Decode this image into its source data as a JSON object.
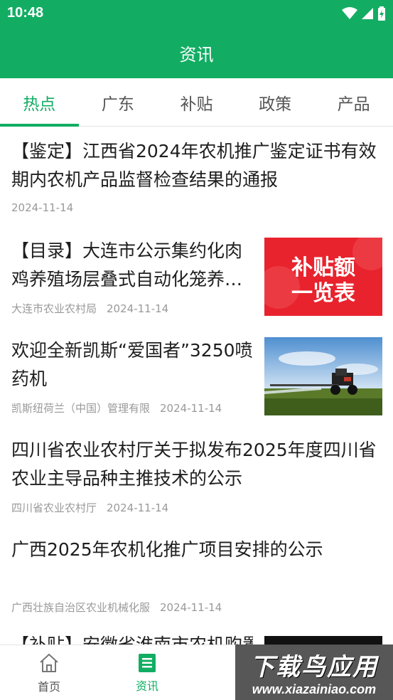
{
  "status_bar": {
    "time": "10:48",
    "icons": [
      "wifi-icon",
      "signal-icon",
      "battery-icon"
    ]
  },
  "app_bar": {
    "title": "资讯"
  },
  "tabs": [
    {
      "label": "热点",
      "active": true
    },
    {
      "label": "广东",
      "active": false
    },
    {
      "label": "补贴",
      "active": false
    },
    {
      "label": "政策",
      "active": false
    },
    {
      "label": "产品",
      "active": false
    }
  ],
  "articles": [
    {
      "title": "【鉴定】江西省2024年农机推广鉴定证书有效期内农机产品监督检查结果的通报",
      "source": "",
      "date": "2024-11-14"
    },
    {
      "title": "【目录】大连市公示集约化肉鸡养殖场层叠式自动化笼养设备补贴额一览表",
      "source": "大连市农业农村局",
      "date": "2024-11-14",
      "thumb_text": [
        "补贴额",
        "一览表"
      ]
    },
    {
      "title": "欢迎全新凯斯“爱国者”3250喷药机",
      "source": "凯斯纽荷兰（中国）管理有限",
      "date": "2024-11-14"
    },
    {
      "title": "四川省农业农村厅关于拟发布2025年度四川省农业主导品种主推技术的公示",
      "source": "四川省农业农村厅",
      "date": "2024-11-14"
    },
    {
      "title": "广西2025年农机化推广项目安排的公示",
      "source": "广西壮族自治区农业机械化服",
      "date": "2024-11-14"
    },
    {
      "title": "【补贴】安徽省淮南市农机购置",
      "source": "",
      "date": ""
    }
  ],
  "bottom_nav": [
    {
      "label": "首页",
      "icon": "home-icon",
      "active": false
    },
    {
      "label": "资讯",
      "icon": "news-icon",
      "active": true
    }
  ],
  "watermark": {
    "main": "下载鸟应用",
    "sub": "www.xiazainiao.com"
  },
  "colors": {
    "brand_green": "#12ad63",
    "thumb_red": "#e8232d"
  }
}
